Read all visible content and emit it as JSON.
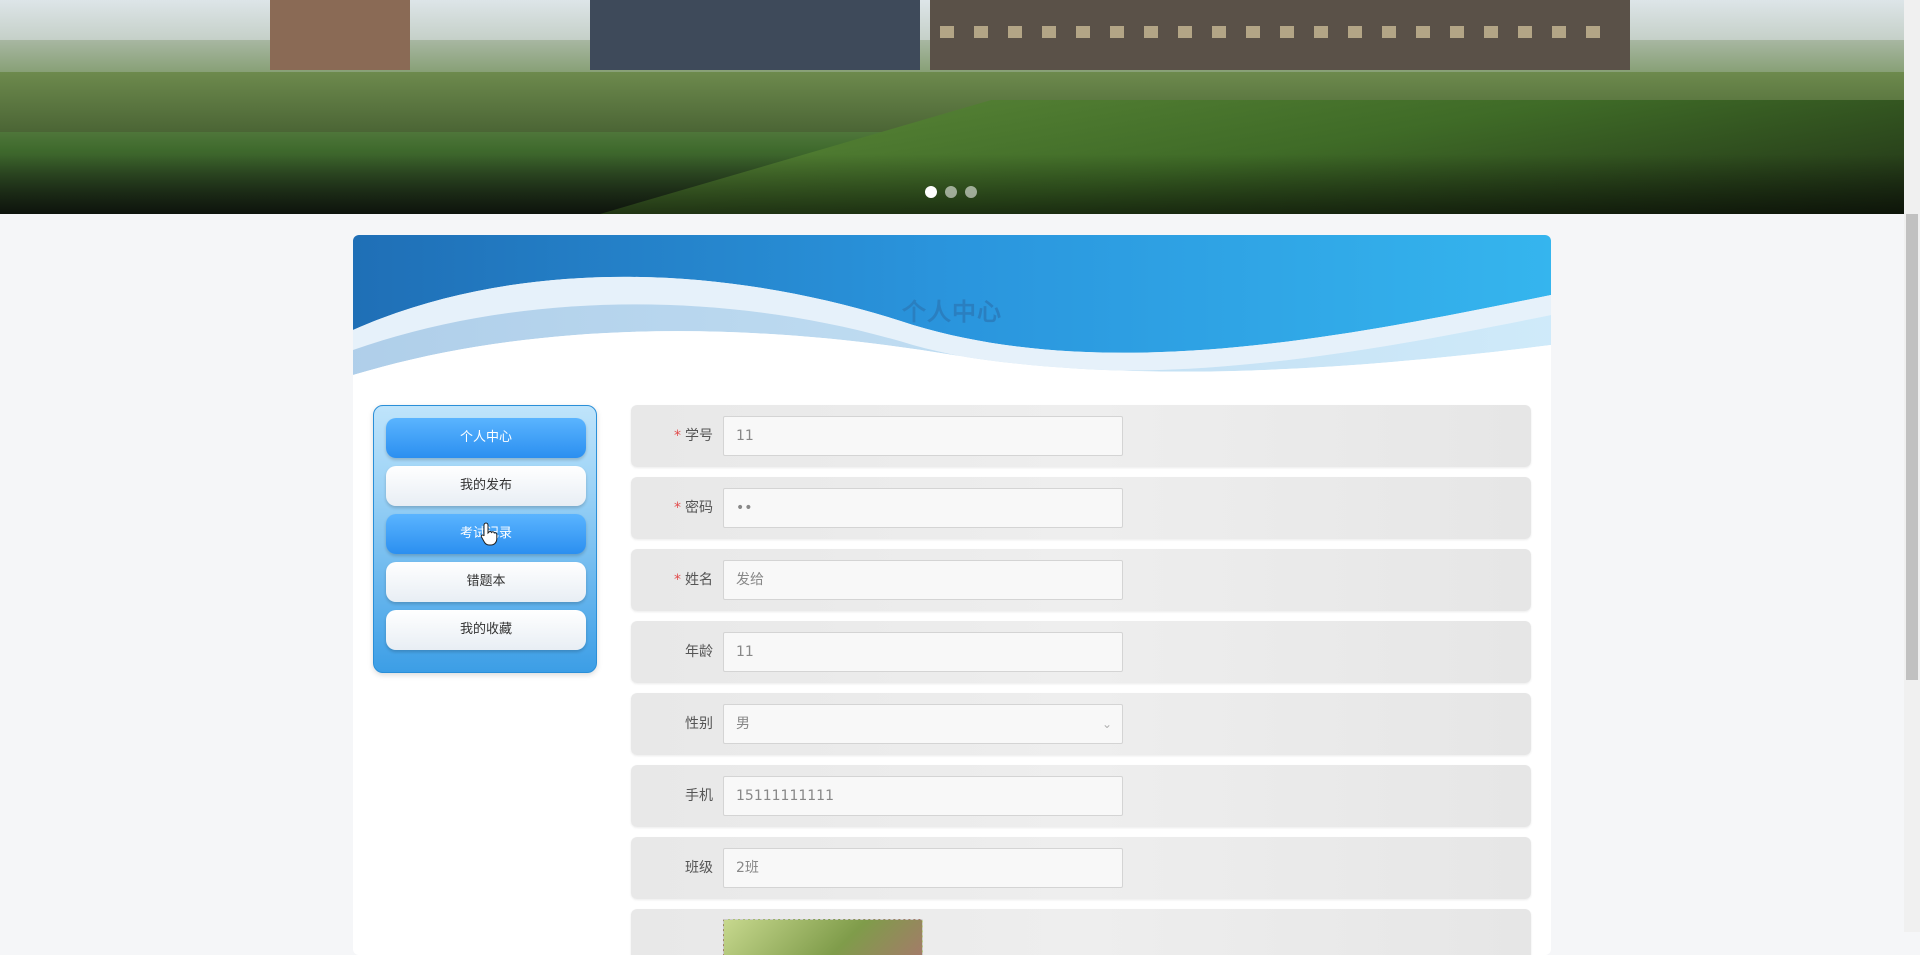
{
  "banner": {
    "dots": 3,
    "active_dot": 1
  },
  "page": {
    "title": "个人中心"
  },
  "menu": {
    "items": [
      {
        "label": "个人中心"
      },
      {
        "label": "我的发布"
      },
      {
        "label": "考试记录"
      },
      {
        "label": "错题本"
      },
      {
        "label": "我的收藏"
      }
    ]
  },
  "form": {
    "student_id": {
      "label": "学号",
      "value": "11",
      "required": true
    },
    "password": {
      "label": "密码",
      "value": "••",
      "required": true
    },
    "name": {
      "label": "姓名",
      "value": "发给",
      "required": true
    },
    "age": {
      "label": "年龄",
      "value": "11",
      "required": false
    },
    "gender": {
      "label": "性别",
      "value": "男",
      "required": false
    },
    "phone": {
      "label": "手机",
      "value": "15111111111",
      "required": false
    },
    "class": {
      "label": "班级",
      "value": "2班",
      "required": false
    }
  },
  "colors": {
    "accent": "#2b8ff0",
    "title": "#2a7fc0",
    "required": "#e14b4b"
  }
}
